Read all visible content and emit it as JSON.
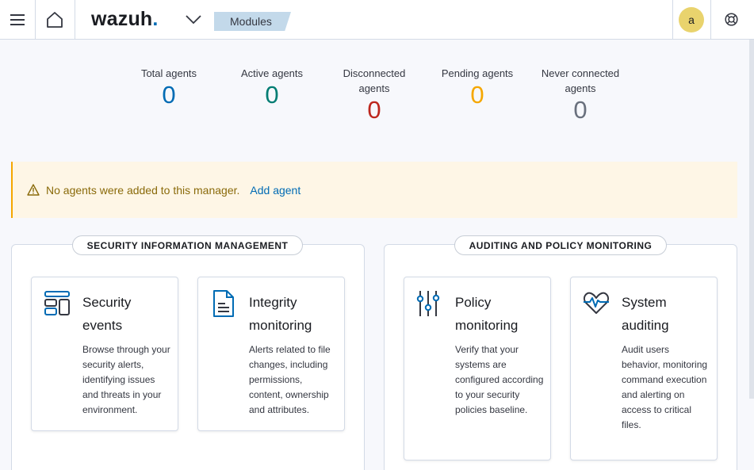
{
  "header": {
    "logo_text": "wazuh",
    "logo_dot": ".",
    "breadcrumb": "Modules",
    "avatar_initial": "a",
    "icons": [
      "menu-icon",
      "home-icon",
      "chevron-down-icon",
      "help-lifebuoy-icon"
    ]
  },
  "stats": [
    {
      "label": "Total agents",
      "value": "0",
      "color": "#006bb4"
    },
    {
      "label": "Active agents",
      "value": "0",
      "color": "#017d73"
    },
    {
      "label": "Disconnected agents",
      "value": "0",
      "color": "#bd271e"
    },
    {
      "label": "Pending agents",
      "value": "0",
      "color": "#f5a700"
    },
    {
      "label": "Never connected agents",
      "value": "0",
      "color": "#69707d"
    }
  ],
  "callout": {
    "icon": "warning-icon",
    "text": "No agents were added to this manager.",
    "link": "Add agent"
  },
  "panels": [
    {
      "title": "SECURITY INFORMATION MANAGEMENT",
      "cards": [
        {
          "title": "Security events",
          "icon": "security-events-icon",
          "description": "Browse through your security alerts, identifying issues and threats in your environment."
        },
        {
          "title": "Integrity monitoring",
          "icon": "document-icon",
          "description": "Alerts related to file changes, including permissions, content, ownership and attributes."
        }
      ]
    },
    {
      "title": "AUDITING AND POLICY MONITORING",
      "cards": [
        {
          "title": "Policy monitoring",
          "icon": "sliders-icon",
          "description": "Verify that your systems are configured according to your security policies baseline."
        },
        {
          "title": "System auditing",
          "icon": "heartbeat-icon",
          "description": "Audit users behavior, monitoring command execution and alerting on access to critical files."
        }
      ]
    }
  ],
  "colors": {
    "accent": "#006bb4",
    "warning_bg": "#fef6e6",
    "warning_border": "#f5a700",
    "breadcrumb_bg": "#c3d9ea"
  }
}
